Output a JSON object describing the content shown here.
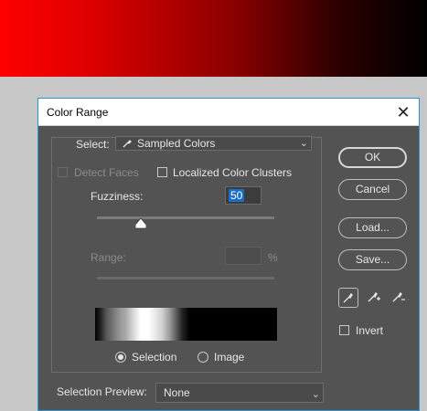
{
  "canvas": {
    "gradient_start": "#ff0000",
    "gradient_end": "#000000"
  },
  "dialog": {
    "title": "Color Range",
    "close_glyph": "✕",
    "select": {
      "label": "Select:",
      "value": "Sampled Colors",
      "icon": "eyedropper-icon"
    },
    "detect_faces": {
      "label": "Detect Faces",
      "checked": false,
      "enabled": false
    },
    "localized_clusters": {
      "label": "Localized Color Clusters",
      "checked": false
    },
    "fuzziness": {
      "label": "Fuzziness:",
      "value": "50",
      "max": 200
    },
    "range": {
      "label": "Range:",
      "value": "",
      "unit": "%",
      "enabled": false
    },
    "preview_mode": {
      "selection_label": "Selection",
      "image_label": "Image",
      "selected": "selection"
    },
    "selection_preview": {
      "label": "Selection Preview:",
      "value": "None"
    },
    "buttons": {
      "ok": "OK",
      "cancel": "Cancel",
      "load": "Load...",
      "save": "Save..."
    },
    "eyedroppers": [
      "eyedropper-icon",
      "eyedropper-plus-icon",
      "eyedropper-minus-icon"
    ],
    "invert": {
      "label": "Invert",
      "checked": false
    },
    "accent": "#2e95d3"
  }
}
